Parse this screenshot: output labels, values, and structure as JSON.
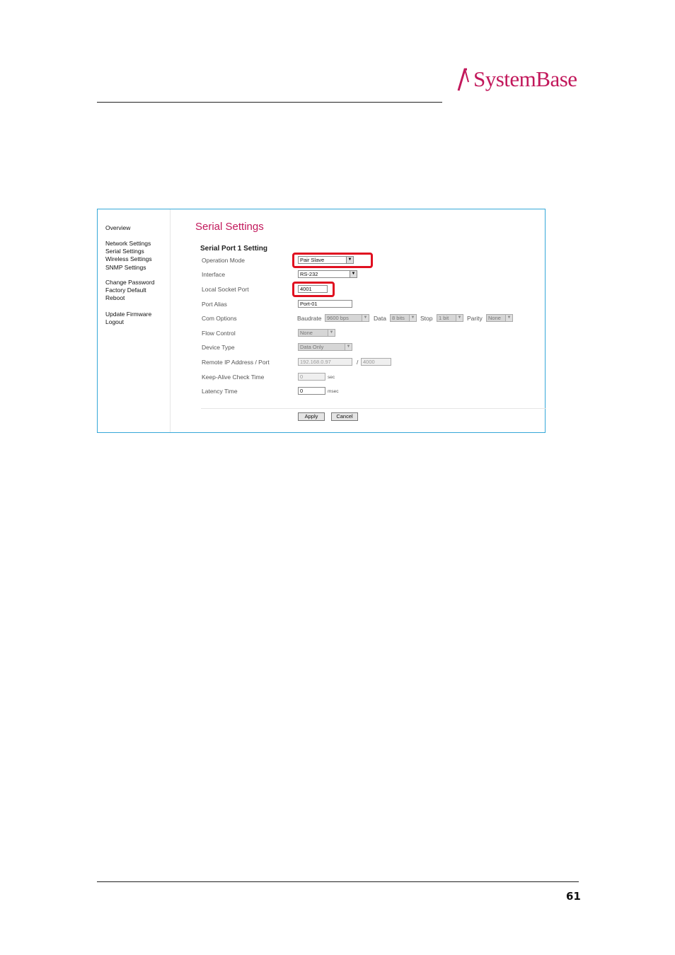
{
  "document": {
    "logo_text": "SystemBase",
    "page_number": "61"
  },
  "sidebar": {
    "groups": [
      [
        "Overview"
      ],
      [
        "Network Settings",
        "Serial Settings",
        "Wireless Settings",
        "SNMP Settings"
      ],
      [
        "Change Password",
        "Factory Default",
        "Reboot"
      ],
      [
        "Update Firmware",
        "Logout"
      ]
    ]
  },
  "main": {
    "title": "Serial Settings",
    "section_title": "Serial Port 1 Setting",
    "fields": {
      "operation_mode": {
        "label": "Operation Mode",
        "value": "Pair Slave"
      },
      "interface": {
        "label": "Interface",
        "value": "RS-232"
      },
      "local_socket_port": {
        "label": "Local Socket Port",
        "value": "4001"
      },
      "port_alias": {
        "label": "Port Alias",
        "value": "Port-01"
      },
      "com_options": {
        "label": "Com Options",
        "baudrate_label": "Baudrate",
        "baudrate": "9600 bps",
        "data_label": "Data",
        "data": "8 bits",
        "stop_label": "Stop",
        "stop": "1 bit",
        "parity_label": "Parity",
        "parity": "None"
      },
      "flow_control": {
        "label": "Flow Control",
        "value": "None"
      },
      "device_type": {
        "label": "Device Type",
        "value": "Data Only"
      },
      "remote_ip": {
        "label": "Remote IP Address / Port",
        "ip": "192.168.0.97",
        "separator": "/",
        "port": "4000"
      },
      "keep_alive": {
        "label": "Keep-Alive Check Time",
        "value": "0",
        "unit": "sec"
      },
      "latency": {
        "label": "Latency Time",
        "value": "0",
        "unit": "msec"
      }
    },
    "buttons": {
      "apply": "Apply",
      "cancel": "Cancel"
    }
  },
  "colors": {
    "brand": "#c2185b",
    "frame_border": "#35a8d8",
    "highlight": "#e01020"
  }
}
